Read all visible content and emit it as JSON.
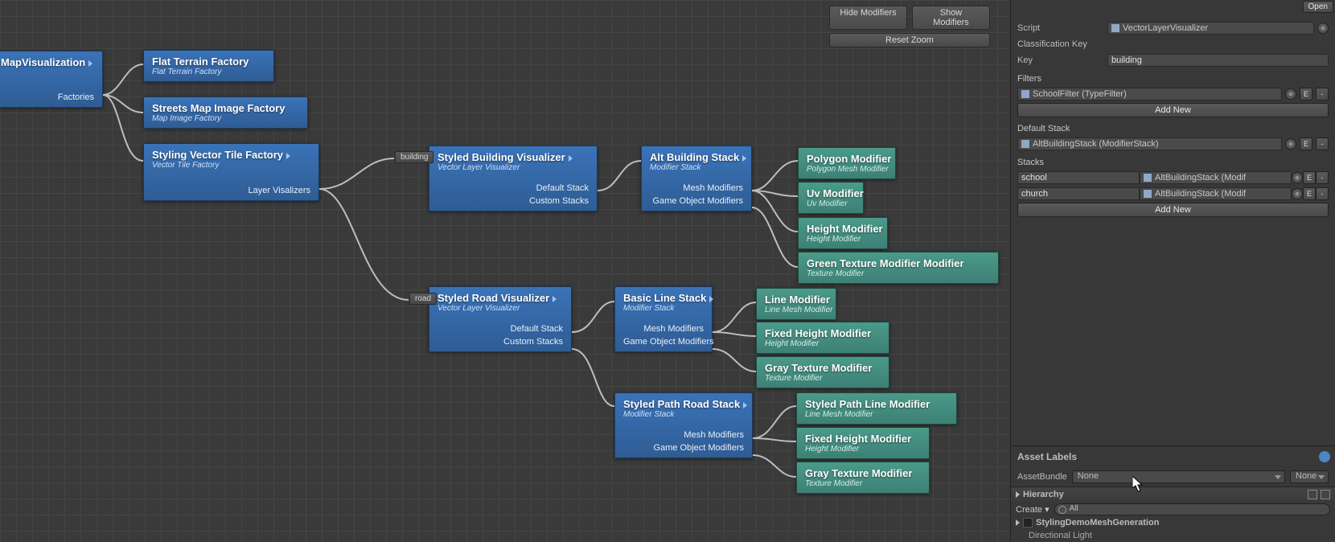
{
  "canvas_buttons": {
    "hide_modifiers": "Hide Modifiers",
    "show_modifiers": "Show Modifiers",
    "reset_zoom": "Reset Zoom"
  },
  "port_labels": {
    "building": "building",
    "road": "road"
  },
  "nodes": {
    "map_vis": {
      "title": "MapVisualization",
      "prop0": "Factories"
    },
    "flat_terrain": {
      "title": "Flat Terrain Factory",
      "sub": "Flat Terrain Factory"
    },
    "streets_map": {
      "title": "Streets Map Image Factory",
      "sub": "Map Image Factory"
    },
    "styling_vector": {
      "title": "Styling Vector Tile Factory",
      "sub": "Vector Tile Factory",
      "prop0": "Layer Visalizers"
    },
    "styled_building": {
      "title": "Styled Building Visualizer",
      "sub": "Vector Layer Visualizer",
      "prop0": "Default Stack",
      "prop1": "Custom Stacks"
    },
    "styled_road": {
      "title": "Styled Road Visualizer",
      "sub": "Vector Layer Visualizer",
      "prop0": "Default Stack",
      "prop1": "Custom Stacks"
    },
    "alt_stack": {
      "title": "Alt Building Stack",
      "sub": "Modifier Stack",
      "prop0": "Mesh Modifiers",
      "prop1": "Game Object Modifiers"
    },
    "basic_line": {
      "title": "Basic Line Stack",
      "sub": "Modifier Stack",
      "prop0": "Mesh Modifiers",
      "prop1": "Game Object Modifiers"
    },
    "styled_path": {
      "title": "Styled Path Road Stack",
      "sub": "Modifier Stack",
      "prop0": "Mesh Modifiers",
      "prop1": "Game Object Modifiers"
    },
    "polygon": {
      "title": "Polygon Modifier",
      "sub": "Polygon Mesh Modifier"
    },
    "uv": {
      "title": "Uv Modifier",
      "sub": "Uv Modifier"
    },
    "height": {
      "title": "Height Modifier",
      "sub": "Height Modifier"
    },
    "green_tex": {
      "title": "Green Texture Modifier Modifier",
      "sub": "Texture Modifier"
    },
    "line_mod": {
      "title": "Line Modifier",
      "sub": "Line Mesh Modifier"
    },
    "fixed_h1": {
      "title": "Fixed Height Modifier",
      "sub": "Height Modifier"
    },
    "gray_tex1": {
      "title": "Gray Texture Modifier",
      "sub": "Texture Modifier"
    },
    "styled_path_line": {
      "title": "Styled Path Line Modifier",
      "sub": "Line Mesh Modifier"
    },
    "fixed_h2": {
      "title": "Fixed Height Modifier",
      "sub": "Height Modifier"
    },
    "gray_tex2": {
      "title": "Gray Texture Modifier",
      "sub": "Texture Modifier"
    }
  },
  "inspector": {
    "open": "Open",
    "script_lbl": "Script",
    "script_val": "VectorLayerVisualizer",
    "class_key_lbl": "Classification Key",
    "key_lbl": "Key",
    "key_val": "building",
    "filters_lbl": "Filters",
    "filter0": "SchoolFilter (TypeFilter)",
    "add_new": "Add New",
    "default_stack_lbl": "Default Stack",
    "default_stack_val": "AltBuildingStack (ModifierStack)",
    "stacks_lbl": "Stacks",
    "stack0_key": "school",
    "stack0_val": "AltBuildingStack (Modif",
    "stack1_key": "church",
    "stack1_val": "AltBuildingStack (Modif",
    "e_btn": "E",
    "minus_btn": "-"
  },
  "asset_labels": {
    "title": "Asset Labels"
  },
  "assetbundle": {
    "lbl": "AssetBundle",
    "val1": "None",
    "val2": "None"
  },
  "hierarchy": {
    "title": "Hierarchy",
    "create": "Create",
    "search_ph": "All",
    "scene": "StylingDemoMeshGeneration",
    "item0": "Directional Light"
  }
}
